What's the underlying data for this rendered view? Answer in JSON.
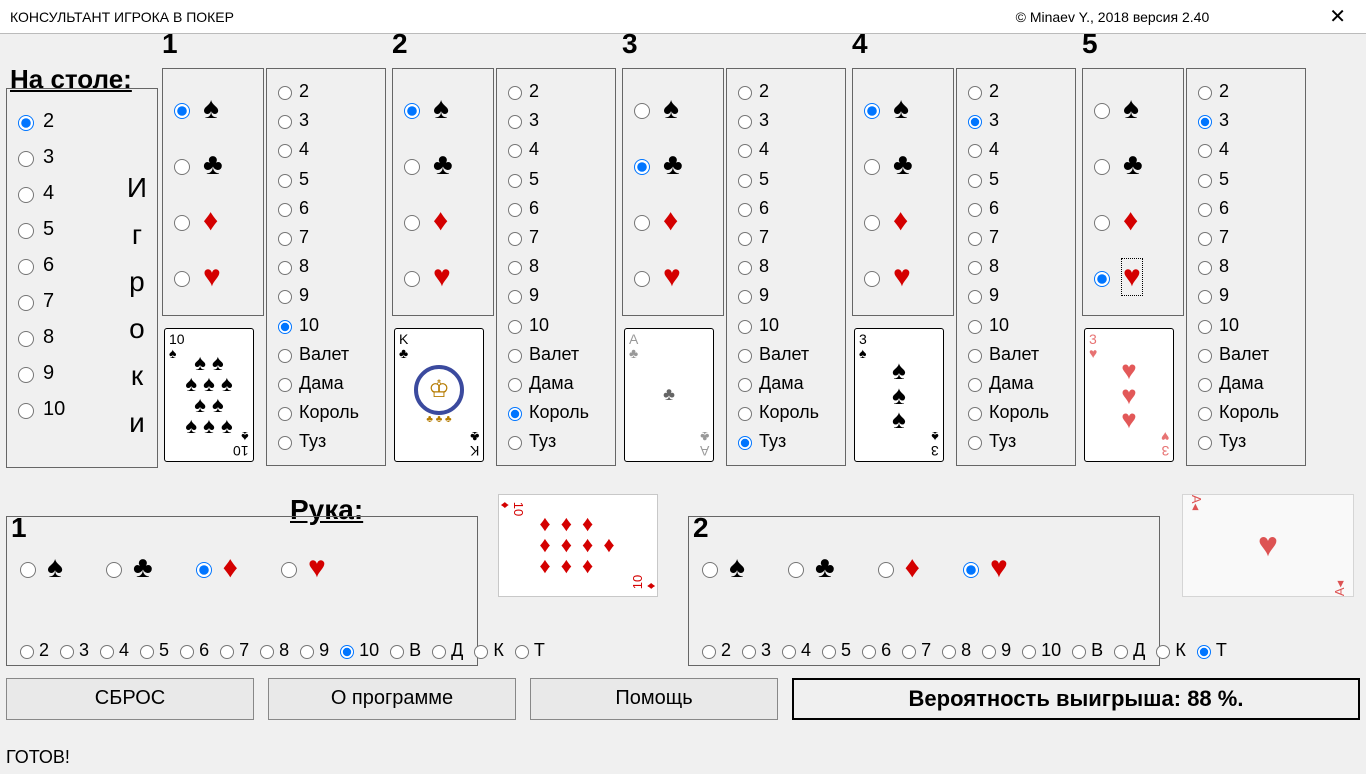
{
  "title": "КОНСУЛЬТАНТ ИГРОКА В ПОКЕР",
  "copyright": "© Minaev Y., 2018 версия 2.40",
  "close": "✕",
  "labels": {
    "na_stole": "На столе:",
    "igroki_vertical": "И\nг\nр\nо\nк\nи",
    "ruka": "Рука:",
    "probability": "Вероятность выигрыша: 88 %.",
    "status": "ГОТОВ!"
  },
  "buttons": {
    "reset": "СБРОС",
    "about": "О программе",
    "help": "Помощь"
  },
  "player_counts": [
    "2",
    "3",
    "4",
    "5",
    "6",
    "7",
    "8",
    "9",
    "10"
  ],
  "player_count_selected": "2",
  "ranks": [
    "2",
    "3",
    "4",
    "5",
    "6",
    "7",
    "8",
    "9",
    "10",
    "Валет",
    "Дама",
    "Король",
    "Туз"
  ],
  "ranks_short": [
    "2",
    "3",
    "4",
    "5",
    "6",
    "7",
    "8",
    "9",
    "10",
    "В",
    "Д",
    "К",
    "Т"
  ],
  "suits": [
    {
      "key": "spade",
      "glyph": "♠",
      "class": ""
    },
    {
      "key": "club",
      "glyph": "♣",
      "class": ""
    },
    {
      "key": "diamond",
      "glyph": "♦",
      "class": "red"
    },
    {
      "key": "heart",
      "glyph": "♥",
      "class": "red"
    }
  ],
  "board": [
    {
      "slot": "1",
      "suit_selected": "spade",
      "rank_selected": "10",
      "card": {
        "display": "ten_spades"
      }
    },
    {
      "slot": "2",
      "suit_selected": "spade",
      "rank_selected": "Король",
      "card": {
        "display": "king_clubs"
      }
    },
    {
      "slot": "3",
      "suit_selected": "club",
      "rank_selected": "Туз",
      "card": {
        "display": "ace_clubs"
      }
    },
    {
      "slot": "4",
      "suit_selected": "spade",
      "rank_selected": "",
      "card": {
        "display": "three_spades"
      }
    },
    {
      "slot": "5",
      "suit_selected": "heart",
      "rank_selected": "3",
      "card": {
        "display": "three_hearts"
      },
      "suit_focus": true
    }
  ],
  "board_rank_alt": {
    "4": "3"
  },
  "hand": [
    {
      "slot": "1",
      "suit_selected": "diamond",
      "rank_selected": "10",
      "card": "ten_diamonds"
    },
    {
      "slot": "2",
      "suit_selected": "heart",
      "rank_selected": "Т",
      "card": "ace_hearts"
    }
  ]
}
